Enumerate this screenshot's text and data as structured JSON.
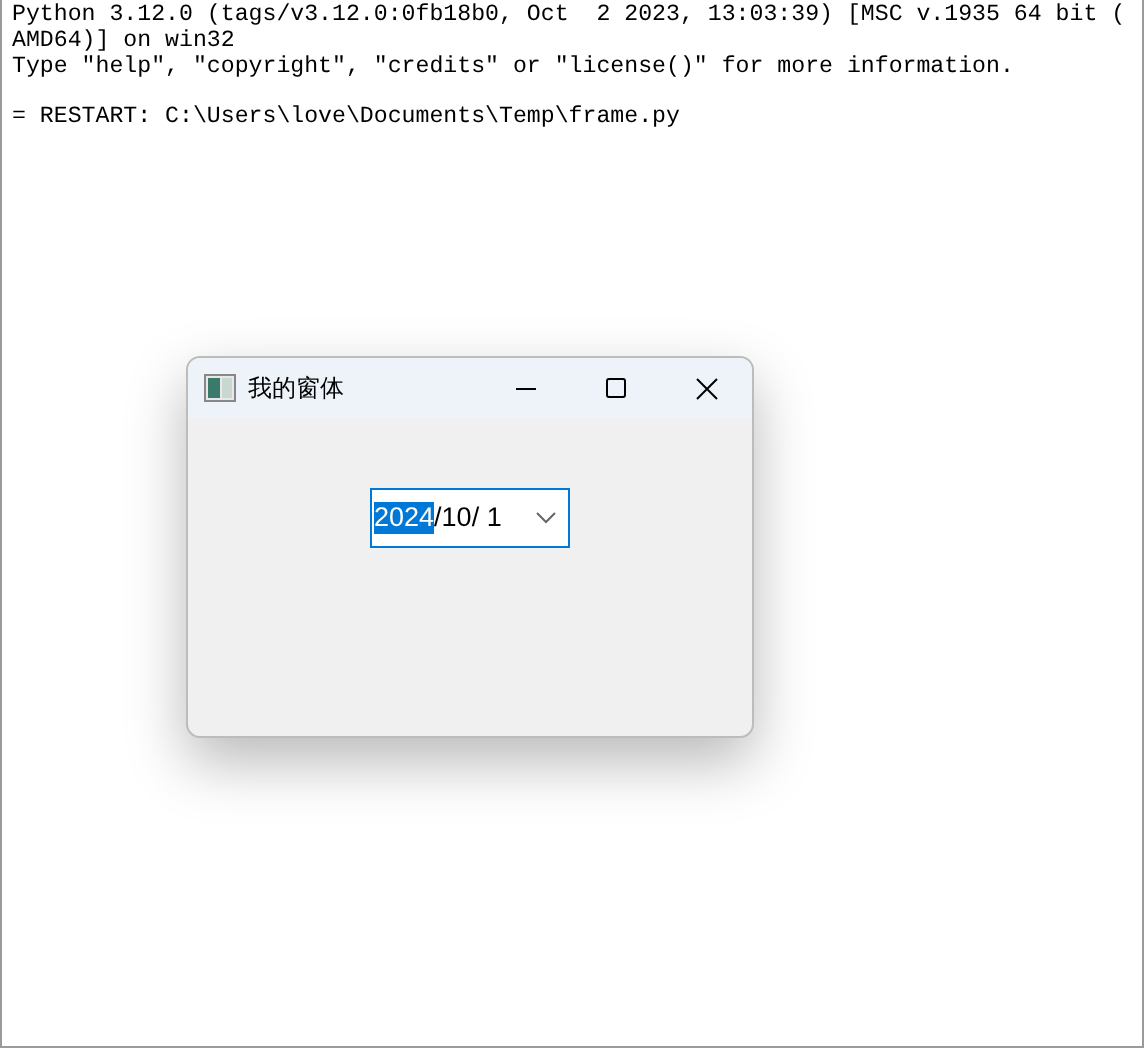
{
  "shell": {
    "lines": [
      "Python 3.12.0 (tags/v3.12.0:0fb18b0, Oct  2 2023, 13:03:39) [MSC v.1935 64 bit (",
      "AMD64)] on win32",
      "Type \"help\", \"copyright\", \"credits\" or \"license()\" for more information."
    ],
    "restart_line": "= RESTART: C:\\Users\\love\\Documents\\Temp\\frame.py"
  },
  "dialog": {
    "title": "我的窗体",
    "date_picker": {
      "segments": [
        {
          "text": "2024",
          "selected": true
        },
        {
          "text": "/10/ 1",
          "selected": false
        }
      ]
    }
  }
}
